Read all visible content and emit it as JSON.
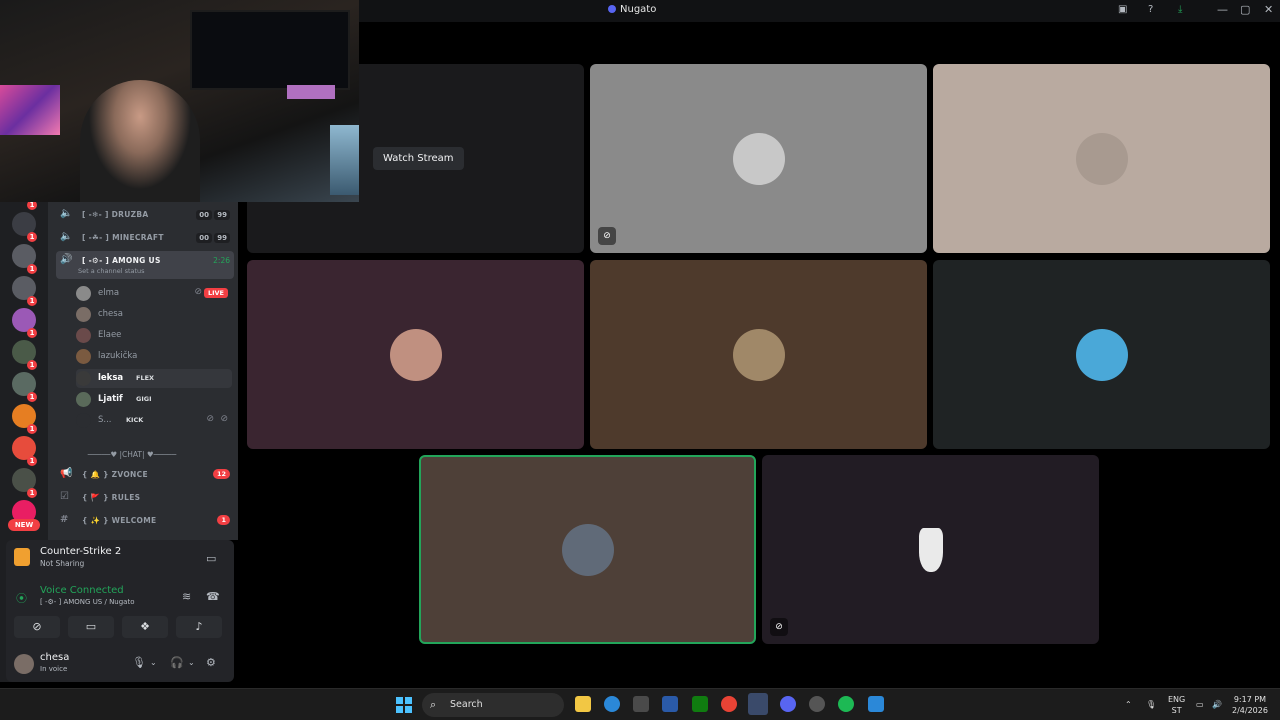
{
  "window": {
    "title": "Nugato"
  },
  "channels": [
    {
      "name": "DRUZBA",
      "prefix": "[ -❄- ]",
      "tag1": "00",
      "tag2": "99"
    },
    {
      "name": "MINECRAFT",
      "prefix": "[ -☘- ]",
      "tag1": "00",
      "tag2": "99"
    },
    {
      "name": "AMONG US",
      "prefix": "[ -⚙- ]",
      "timer": "2:26",
      "status": "Set a channel status"
    }
  ],
  "members": [
    {
      "name": "elma",
      "live": "LIVE"
    },
    {
      "name": "chesa"
    },
    {
      "name": "Elaee"
    },
    {
      "name": "lazukička"
    },
    {
      "name": "leksa",
      "role": "FLEX"
    },
    {
      "name": "Ljatif",
      "role": "GIGI"
    },
    {
      "name": "S...",
      "role": "KICK"
    }
  ],
  "category_divider": "─────♥ |CHAT| ♥─────",
  "text_channels": [
    {
      "name": "ZVONCE",
      "prefix": "{ 🔔 }",
      "badge": "12"
    },
    {
      "name": "RULES",
      "prefix": "{ 🚩 }"
    },
    {
      "name": "WELCOME",
      "prefix": "{ ✨ }",
      "badge": "1"
    }
  ],
  "server_badges": [
    "1",
    "1",
    "1",
    "1",
    "1",
    "1",
    "1",
    "1",
    "1",
    "1",
    "1",
    "1"
  ],
  "server_new": "NEW",
  "activity": {
    "game": "Counter-Strike 2",
    "sub": "Not Sharing"
  },
  "voice": {
    "label": "Voice Connected",
    "sub": "[ -⚙- ] AMONG US / Nugato"
  },
  "user": {
    "name": "chesa",
    "status": "In voice"
  },
  "stage": {
    "watch_label": "Watch Stream"
  },
  "taskbar": {
    "search": "Search",
    "lang1": "ENG",
    "lang2": "ST",
    "time": "9:17 PM",
    "date": "2/4/2026"
  },
  "colors": {
    "accent": "#5865f2",
    "online": "#23a55a",
    "danger": "#f23f43",
    "tile_bg": "#2b2d31"
  }
}
